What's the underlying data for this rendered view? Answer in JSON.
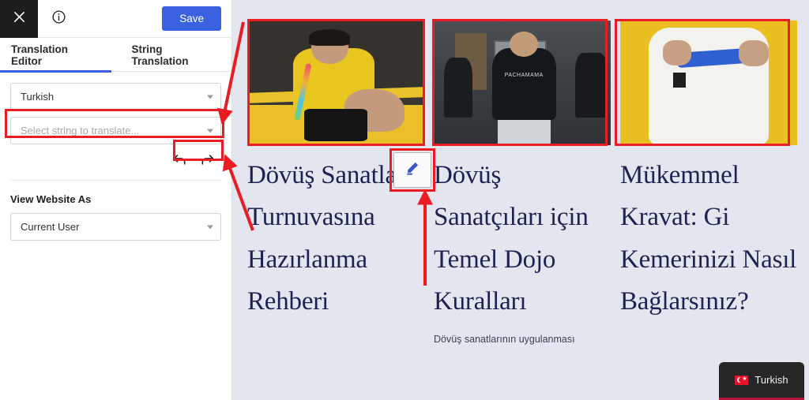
{
  "sidebar": {
    "topbar": {
      "close_icon": "close-icon",
      "info_icon": "info-icon",
      "save_label": "Save"
    },
    "tabs": [
      {
        "label": "Translation Editor",
        "active": true
      },
      {
        "label": "String Translation",
        "active": false
      }
    ],
    "language_select": {
      "value": "Turkish",
      "caret_icon": "chevron-down-icon"
    },
    "string_select": {
      "placeholder": "Select string to translate...",
      "value": "Select string to translate...",
      "caret_icon": "chevron-down-icon"
    },
    "history": {
      "undo_icon": "undo-arrow-icon",
      "redo_icon": "redo-arrow-icon"
    },
    "view_website_as": {
      "title": "View Website As",
      "value": "Current User",
      "caret_icon": "chevron-down-icon"
    }
  },
  "preview": {
    "edit_button": {
      "icon": "pencil-edit-icon"
    },
    "language_badge": {
      "label": "Turkish",
      "flag_icon": "turkish-flag-icon"
    },
    "cards": [
      {
        "image_alt": "Fighter in yellow shirt wrapping hand tape in boxing ring",
        "title": "Dövüş Sanatları Turnuvasına Hazırlanma Rehberi",
        "excerpt": ""
      },
      {
        "image_alt": "Smiling man in black Pachamama t-shirt at gym",
        "image_text": "PACHAMAMA",
        "title": "Dövüş Sanatçıları için Temel Dojo Kuralları",
        "excerpt": "Dövüş sanatlarının uygulanması"
      },
      {
        "image_alt": "Person in white gi tying a blue belt on yellow mat",
        "title": "Mükemmel Kravat: Gi Kemerinizi Nasıl Bağlarsınız?",
        "excerpt": ""
      }
    ]
  },
  "colors": {
    "accent_blue": "#3a62e0",
    "annotation_red": "#ec1c24",
    "title_navy": "#1c2352",
    "preview_bg": "#e4e6ef",
    "badge_bg": "#262626",
    "flag_red": "#e8112d"
  }
}
